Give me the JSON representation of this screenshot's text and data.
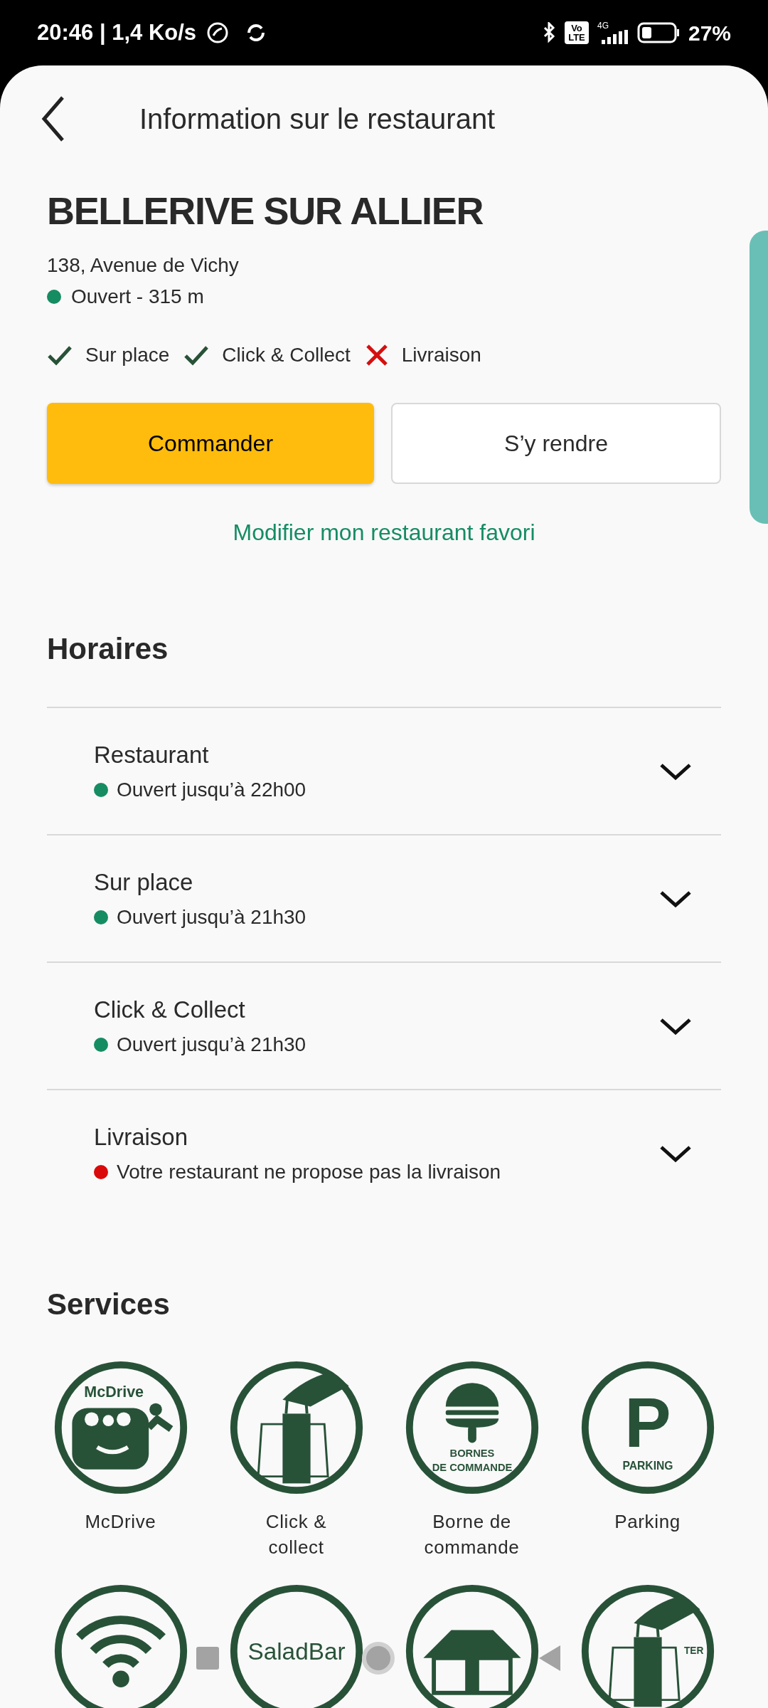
{
  "status_bar": {
    "time": "20:46 | 1,4 Ko/s",
    "volte": [
      "Vo",
      "LTE"
    ],
    "network": "4G",
    "battery": "27%"
  },
  "header": {
    "title": "Information sur le restaurant"
  },
  "restaurant": {
    "name": "BELLERIVE SUR ALLIER",
    "address": "138, Avenue de Vichy",
    "status": "Ouvert - 315 m",
    "color": "#168c63"
  },
  "features": [
    {
      "label": "Sur place",
      "available": true
    },
    {
      "label": "Click & Collect",
      "available": true
    },
    {
      "label": "Livraison",
      "available": false
    }
  ],
  "buttons": [
    {
      "label": "Commander",
      "kind": "primary"
    },
    {
      "label": "S’y rendre",
      "kind": "secondary"
    }
  ],
  "link": "Modifier mon restaurant favori",
  "hours": {
    "title": "Horaires",
    "rows": [
      {
        "title": "Restaurant",
        "status": "Ouvert jusqu’à 22h00",
        "color": "#168c63",
        "expanded": false
      },
      {
        "title": "Sur place",
        "status": "Ouvert jusqu’à 21h30",
        "color": "#168c63",
        "expanded": false
      },
      {
        "title": "Click & Collect",
        "status": "Ouvert jusqu’à 21h30",
        "color": "#168c63",
        "expanded": false
      },
      {
        "title": "Livraison",
        "status": "Votre restaurant ne propose pas la livraison",
        "color": "#da0a0a",
        "expanded": false
      }
    ]
  },
  "services": {
    "title": "Services",
    "items": [
      {
        "label": "McDrive",
        "kind": "drive",
        "emblem": [
          "McDrive"
        ]
      },
      {
        "label": "Click & collect",
        "kind": "bag"
      },
      {
        "label": "Borne de commande",
        "kind": "kiosk",
        "emblem": [
          "BORNES",
          "DE COMMANDE"
        ]
      },
      {
        "label": "Parking",
        "kind": "parking",
        "emblem": [
          "P",
          "PARKING"
        ]
      },
      {
        "kind": "wifi"
      },
      {
        "kind": "saladbar",
        "emblem": [
          "SaladBar"
        ]
      },
      {
        "kind": "restaurant"
      },
      {
        "kind": "bag",
        "emblem": [
          "TER"
        ]
      }
    ]
  },
  "nav_bar": [
    {
      "kind": "recents"
    },
    {
      "kind": "home"
    },
    {
      "kind": "back"
    }
  ]
}
